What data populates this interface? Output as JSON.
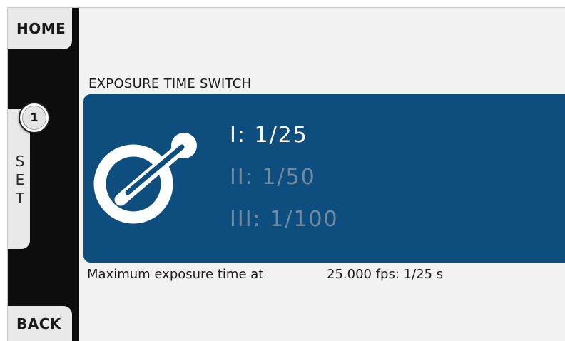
{
  "nav": {
    "home_label": "HOME",
    "set_label": [
      "S",
      "E",
      "T"
    ],
    "back_label": "BACK"
  },
  "callout": {
    "number": "1"
  },
  "section": {
    "title": "EXPOSURE TIME SWITCH"
  },
  "options": [
    {
      "label": "I: 1/25",
      "active": true
    },
    {
      "label": "II: 1/50",
      "active": false
    },
    {
      "label": "III: 1/100",
      "active": false
    }
  ],
  "info": {
    "label": "Maximum exposure time at",
    "value": "25.000 fps:  1/25 s"
  },
  "colors": {
    "panel": "#0e4e7e",
    "active_text": "#ffffff",
    "inactive_text": "#6f8aa3",
    "rail": "#0d0d0d",
    "side_button": "#e9e9e9"
  },
  "icons": {
    "panel_icon": "shutter-angle-icon"
  }
}
